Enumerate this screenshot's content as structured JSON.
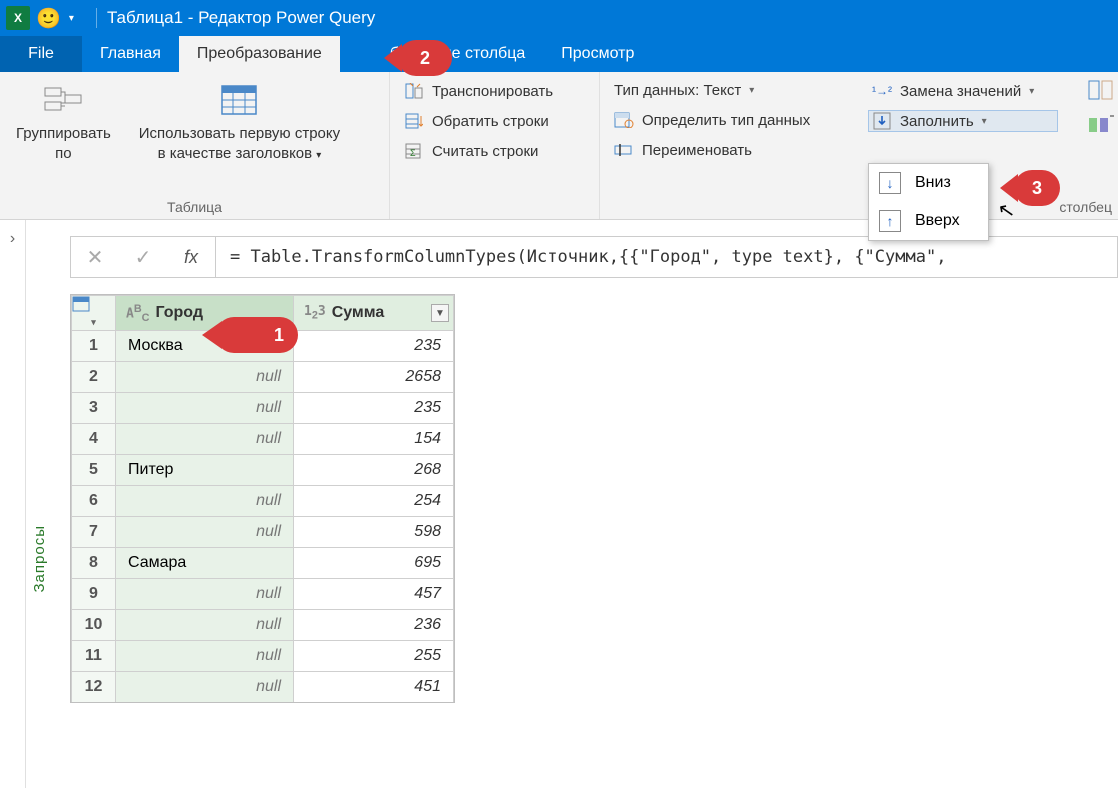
{
  "title": "Таблица1 - Редактор Power Query",
  "tabs": {
    "file": "File",
    "home": "Главная",
    "transform": "Преобразование",
    "addcol_partial": "бавление столбца",
    "view": "Просмотр"
  },
  "ribbon": {
    "group_table_label": "Таблица",
    "group_by": "Группировать\nпо",
    "use_first_row": "Использовать первую строку\nв качестве заголовков",
    "transpose": "Транспонировать",
    "reverse_rows": "Обратить строки",
    "count_rows": "Считать строки",
    "data_type": "Тип данных: Текст",
    "detect_type": "Определить тип данных",
    "rename": "Переименовать",
    "replace_values": "Замена значений",
    "fill": "Заполнить",
    "fill_down": "Вниз",
    "fill_up": "Вверх",
    "right_trunc": "",
    "group_col_label": "столбец"
  },
  "sidebar": {
    "label": "Запросы"
  },
  "formula": "= Table.TransformColumnTypes(Источник,{{\"Город\", type text}, {\"Сумма\", ",
  "columns": {
    "city": "Город",
    "sum": "Сумма"
  },
  "type_icons": {
    "text": "ABC",
    "number": "1₂3"
  },
  "rows": [
    {
      "n": 1,
      "city": "Москва",
      "sum": 235
    },
    {
      "n": 2,
      "city": null,
      "sum": 2658
    },
    {
      "n": 3,
      "city": null,
      "sum": 235
    },
    {
      "n": 4,
      "city": null,
      "sum": 154
    },
    {
      "n": 5,
      "city": "Питер",
      "sum": 268
    },
    {
      "n": 6,
      "city": null,
      "sum": 254
    },
    {
      "n": 7,
      "city": null,
      "sum": 598
    },
    {
      "n": 8,
      "city": "Самара",
      "sum": 695
    },
    {
      "n": 9,
      "city": null,
      "sum": 457
    },
    {
      "n": 10,
      "city": null,
      "sum": 236
    },
    {
      "n": 11,
      "city": null,
      "sum": 255
    },
    {
      "n": 12,
      "city": null,
      "sum": 451
    }
  ],
  "null_text": "null",
  "callouts": {
    "c1": "1",
    "c2": "2",
    "c3": "3"
  }
}
